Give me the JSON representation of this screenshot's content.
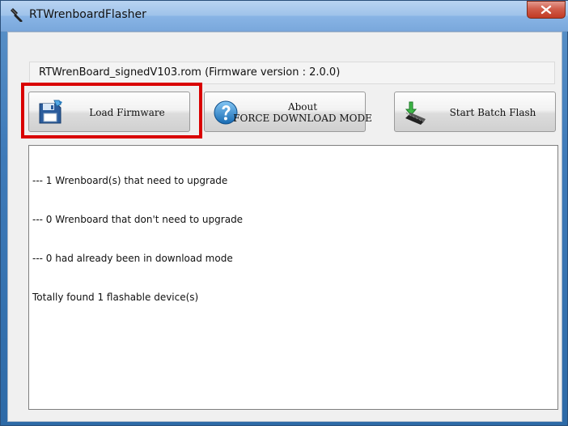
{
  "window": {
    "title": "RTWrenboardFlasher",
    "close_glyph": "x"
  },
  "firmware": {
    "file_text": "RTWrenBoard_signedV103.rom (Firmware version : 2.0.0)"
  },
  "buttons": {
    "load_firmware": "Load Firmware",
    "about_line1": "About",
    "about_line2": "FORCE DOWNLOAD MODE",
    "start_batch_flash": "Start Batch Flash"
  },
  "log": {
    "lines": [
      "--- 1 Wrenboard(s) that need to upgrade",
      "--- 0 Wrenboard that don't need to upgrade",
      "--- 0 had already been in download mode",
      "Totally found 1 flashable device(s)"
    ]
  },
  "icons": {
    "app": "wrench-icon",
    "load": "floppy-disk-icon",
    "about": "question-icon",
    "flash": "chip-download-icon",
    "close": "close-icon"
  },
  "colors": {
    "highlight": "#d90000",
    "titlebar": "#9fc3ea",
    "close": "#c23a24",
    "window": "#f0f0f0"
  }
}
